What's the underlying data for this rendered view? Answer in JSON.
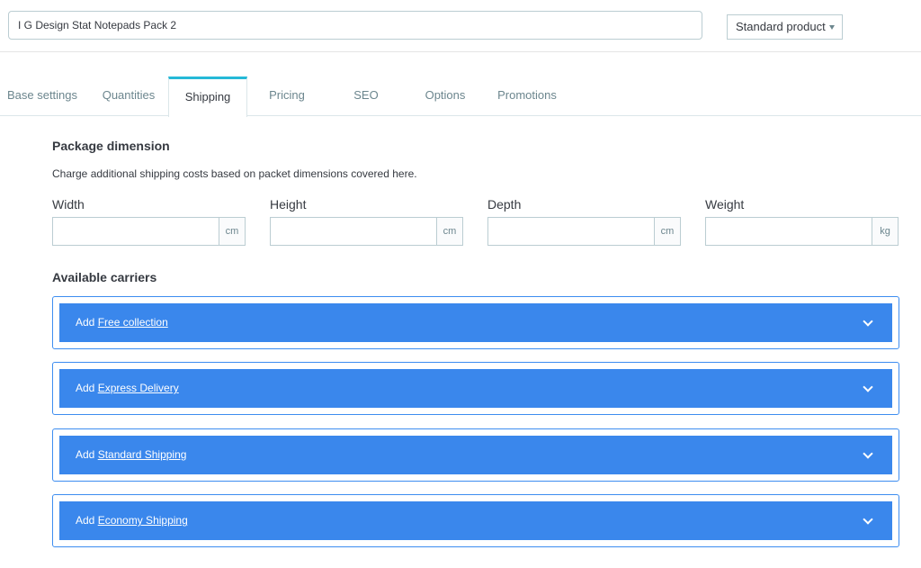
{
  "header": {
    "product_name": "I G Design Stat Notepads Pack 2",
    "product_type": "Standard product"
  },
  "tabs": [
    {
      "label": "Base settings"
    },
    {
      "label": "Quantities"
    },
    {
      "label": "Shipping",
      "active": true
    },
    {
      "label": "Pricing"
    },
    {
      "label": "SEO"
    },
    {
      "label": "Options"
    },
    {
      "label": "Promotions"
    }
  ],
  "package": {
    "title": "Package dimension",
    "help": "Charge additional shipping costs based on packet dimensions covered here.",
    "fields": [
      {
        "label": "Width",
        "unit": "cm",
        "value": ""
      },
      {
        "label": "Height",
        "unit": "cm",
        "value": ""
      },
      {
        "label": "Depth",
        "unit": "cm",
        "value": ""
      },
      {
        "label": "Weight",
        "unit": "kg",
        "value": ""
      }
    ]
  },
  "carriers": {
    "title": "Available carriers",
    "prefix": "Add",
    "items": [
      {
        "name": "Free collection"
      },
      {
        "name": "Express Delivery"
      },
      {
        "name": "Standard Shipping"
      },
      {
        "name": "Economy Shipping"
      }
    ]
  },
  "colors": {
    "accent_tab": "#25b9d7",
    "carrier_blue": "#3a87ec"
  },
  "icons": {
    "type_select": "caret-down-icon",
    "carrier_toggle": "chevron-down-icon"
  }
}
